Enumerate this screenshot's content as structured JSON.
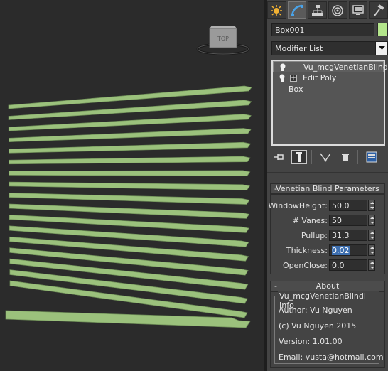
{
  "viewport": {
    "object_color": "#9bc17c",
    "viewcube_label": "TOP"
  },
  "command_panel": {
    "tabs": [
      {
        "icon": "create-sun-icon"
      },
      {
        "icon": "modify-icon"
      },
      {
        "icon": "hierarchy-icon"
      },
      {
        "icon": "motion-icon"
      },
      {
        "icon": "display-icon"
      },
      {
        "icon": "utilities-hammer-icon"
      }
    ],
    "object_name": "Box001",
    "object_color": "#b4e68c",
    "modifier_list_label": "Modifier List",
    "stack": [
      {
        "label": "Vu_mcgVenetianBlind",
        "selected": true
      },
      {
        "label": "Edit Poly",
        "expandable": true
      },
      {
        "label": "Box",
        "base": true
      }
    ]
  },
  "rollouts": {
    "venetian": {
      "title": "Venetian Blind Parameters",
      "collapse_symbol": "-",
      "params": [
        {
          "label": "WindowHeight:",
          "value": "50.0"
        },
        {
          "label": "# Vanes:",
          "value": "50"
        },
        {
          "label": "Pullup:",
          "value": "31.3"
        },
        {
          "label": "Thickness:",
          "value": "0.02"
        },
        {
          "label": "OpenClose:",
          "value": "0.0"
        }
      ]
    },
    "about": {
      "title": "About",
      "collapse_symbol": "-",
      "group_title": "Vu_mcgVenetianBlindl Info",
      "lines": [
        "Author: Vu Nguyen",
        "(c) Vu Nguyen 2015",
        "Version: 1.01.00",
        "Email: vusta@hotmail.com"
      ]
    }
  }
}
